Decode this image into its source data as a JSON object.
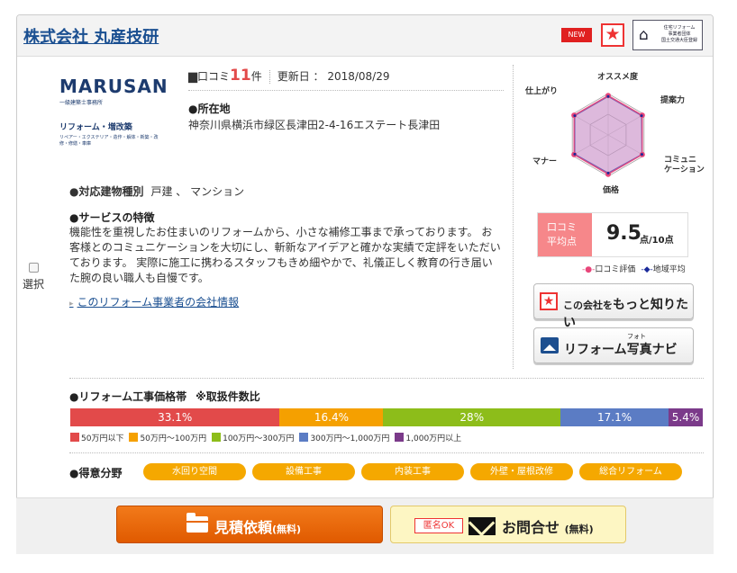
{
  "header": {
    "company_name": "株式会社 丸産技研",
    "new_badge": "NEW",
    "star_icon": "★",
    "assoc_badge_lines": [
      "住宅リフォーム",
      "事業者団体",
      "国土交通大臣登録"
    ]
  },
  "select": {
    "label": "選択"
  },
  "logo": {
    "brand": "MARUSAN",
    "sub1": "一級建築士事務所",
    "sub2": "リフォーム・増改築",
    "sub3": "リペアー・エクステリア・造作・解体・新築・改修・修繕・車庫"
  },
  "review": {
    "prefix": "口コミ",
    "count": "11",
    "suffix": "件",
    "updated_label": "更新日 ： 2018/08/29"
  },
  "address": {
    "title": "●所在地",
    "value": "神奈川県横浜市緑区長津田2-4-16エステート長津田"
  },
  "building": {
    "title": "●対応建物種別",
    "value": "戸建 、 マンション"
  },
  "service": {
    "title": "●サービスの特徴",
    "text": "機能性を重視したお住まいのリフォームから、小さな補修工事まで承っております。 お客様とのコミュニケーションを大切にし、斬新なアイデアと確かな実績で定評をいただいております。 実際に施工に携わるスタッフもきめ細やかで、礼儀正しく教育の行き届いた腕の良い職人も自慢です。",
    "link": "このリフォーム事業者の会社情報"
  },
  "radar": {
    "axes": [
      "オススメ度",
      "提案力",
      "コミュニケーション",
      "価格",
      "マナー",
      "仕上がり"
    ],
    "axis_label_display": [
      "オススメ度",
      "提案力",
      "コミュニ\nケーション",
      "価格",
      "マナー",
      "仕上がり"
    ],
    "company_scores": [
      9.5,
      9.5,
      9.5,
      9.5,
      9.5,
      9.5
    ],
    "area_average": [
      9.3,
      9.3,
      9.4,
      9.2,
      9.3,
      9.3
    ],
    "max": 10,
    "company_color": "#e8467a",
    "average_color": "#1a2a9a",
    "legend_company": "口コミ評価",
    "legend_average": "地域平均"
  },
  "score": {
    "tag": "口コミ\n平均点",
    "value": "9.5",
    "unit": "点/10点"
  },
  "buttons": {
    "know_more_small": "この会社を",
    "know_more_big": "もっと知りたい",
    "photo_ruby": "フォト",
    "photo_label": "リフォーム写真ナビ",
    "quote_label": "見積依頼",
    "quote_sub": "(無料)",
    "anon_badge": "匿名OK",
    "contact_label": "お問合せ",
    "contact_sub": "(無料)"
  },
  "price": {
    "title": "●リフォーム工事価格帯",
    "note": "※取扱件数比",
    "segments": [
      {
        "label": "50万円以下",
        "percent": 33.1,
        "text": "33.1%",
        "color": "#e24a4a"
      },
      {
        "label": "50万円～100万円",
        "percent": 16.4,
        "text": "16.4%",
        "color": "#f5a000"
      },
      {
        "label": "100万円～300万円",
        "percent": 28,
        "text": "28%",
        "color": "#8dbd1a"
      },
      {
        "label": "300万円～1,000万円",
        "percent": 17.1,
        "text": "17.1%",
        "color": "#5b7cc4"
      },
      {
        "label": "1,000万円以上",
        "percent": 5.4,
        "text": "5.4%",
        "color": "#7b3a8a"
      }
    ]
  },
  "specialties": {
    "title": "●得意分野",
    "items": [
      "水回り空間",
      "設備工事",
      "内装工事",
      "外壁・屋根改修",
      "総合リフォーム"
    ]
  }
}
